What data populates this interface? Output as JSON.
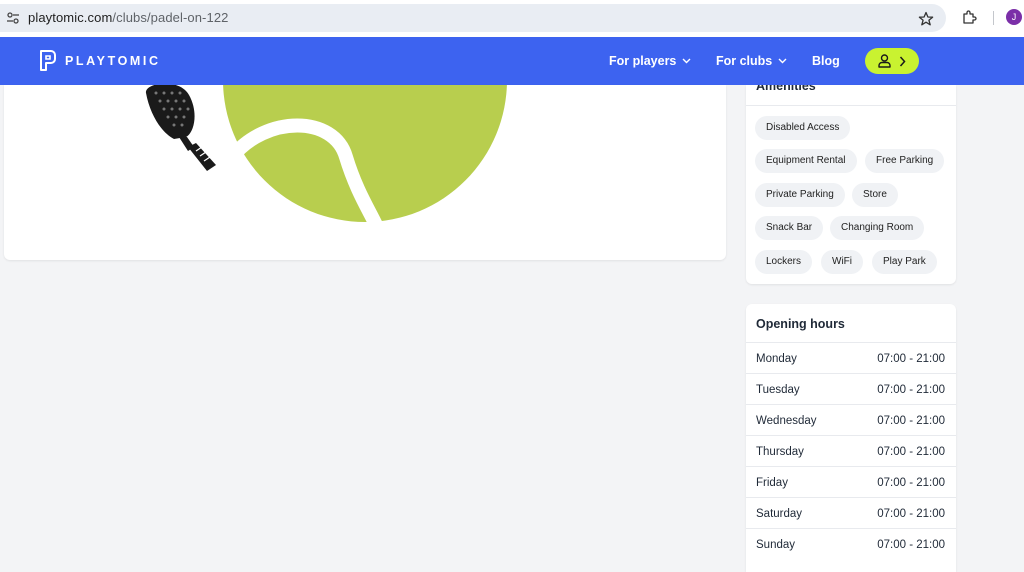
{
  "browser": {
    "url_host": "playtomic.com",
    "url_path": "/clubs/padel-on-122",
    "profile_initial": "J",
    "icons": [
      "site-settings-icon",
      "bookmark-star-icon",
      "extensions-icon",
      "profile-avatar"
    ]
  },
  "header": {
    "logo_text": "PLAYTOMIC",
    "nav": {
      "for_players": "For players",
      "for_clubs": "For clubs",
      "blog": "Blog"
    },
    "icons": [
      "logo-mark",
      "chevron-down-icon",
      "user-icon",
      "chevron-right-icon"
    ]
  },
  "amenities": {
    "title": "Amenities",
    "items": [
      "Disabled Access",
      "Equipment Rental",
      "Free Parking",
      "Private Parking",
      "Store",
      "Snack Bar",
      "Changing Room",
      "Lockers",
      "WiFi",
      "Play Park"
    ]
  },
  "opening_hours": {
    "title": "Opening hours",
    "rows": [
      {
        "day": "Monday",
        "hours": "07:00 - 21:00"
      },
      {
        "day": "Tuesday",
        "hours": "07:00 - 21:00"
      },
      {
        "day": "Wednesday",
        "hours": "07:00 - 21:00"
      },
      {
        "day": "Thursday",
        "hours": "07:00 - 21:00"
      },
      {
        "day": "Friday",
        "hours": "07:00 - 21:00"
      },
      {
        "day": "Saturday",
        "hours": "07:00 - 21:00"
      },
      {
        "day": "Sunday",
        "hours": "07:00 - 21:00"
      }
    ]
  },
  "colors": {
    "brand_blue": "#3d63f0",
    "accent_lime": "#c9f230",
    "ball_green": "#b8ce4e"
  }
}
